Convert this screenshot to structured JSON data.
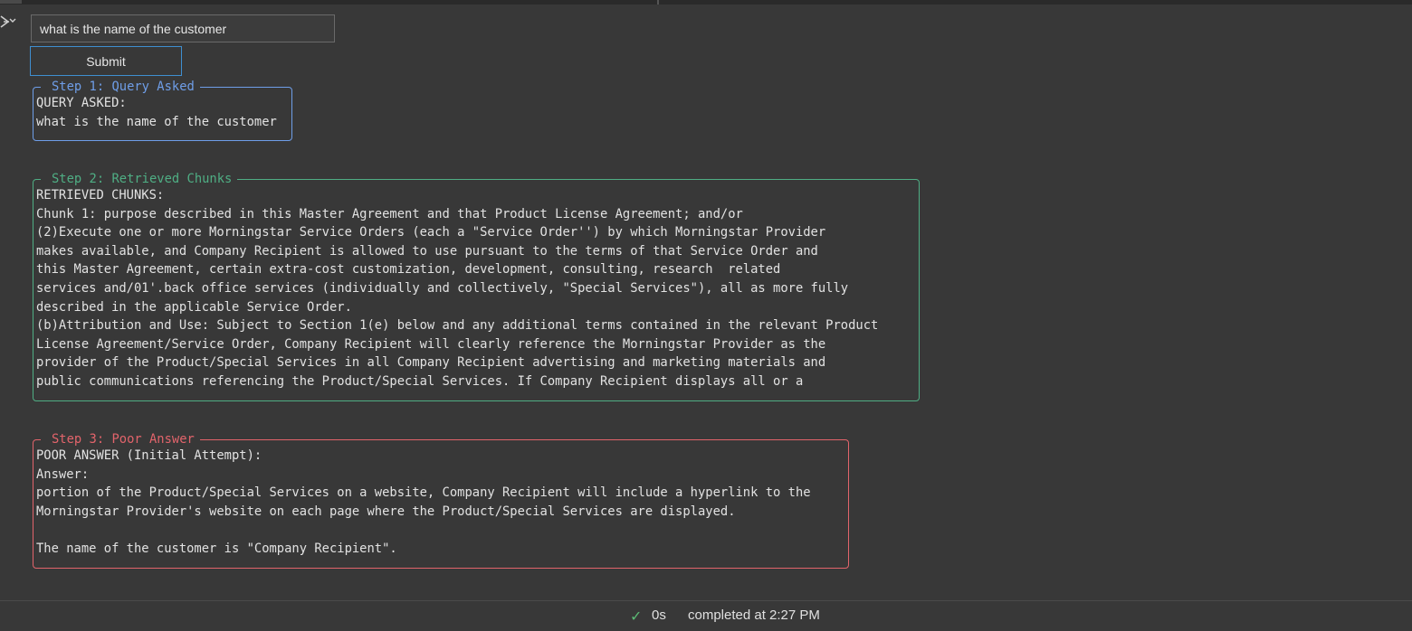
{
  "query": {
    "value": "what is the name of the customer"
  },
  "submit_label": "Submit",
  "steps": [
    {
      "title": "Step 1: Query Asked",
      "lines": [
        "QUERY ASKED:",
        "what is the name of the customer"
      ]
    },
    {
      "title": "Step 2: Retrieved Chunks",
      "lines": [
        "RETRIEVED CHUNKS:",
        "Chunk 1: purpose described in this Master Agreement and that Product License Agreement; and/or",
        "(2)Execute one or more Morningstar Service Orders (each a \"Service Order'') by which Morningstar Provider",
        "makes available, and Company Recipient is allowed to use pursuant to the terms of that Service Order and",
        "this Master Agreement, certain extra-cost customization, development, consulting, research  related",
        "services and/01'.back office services (individually and collectively, \"Special Services\"), all as more fully",
        "described in the applicable Service Order.",
        "(b)Attribution and Use: Subject to Section 1(e) below and any additional terms contained in the relevant Product",
        "License Agreement/Service Order, Company Recipient will clearly reference the Morningstar Provider as the",
        "provider of the Product/Special Services in all Company Recipient advertising and marketing materials and",
        "public communications referencing the Product/Special Services. If Company Recipient displays all or a"
      ]
    },
    {
      "title": "Step 3: Poor Answer",
      "lines": [
        "POOR ANSWER (Initial Attempt):",
        "Answer:",
        "portion of the Product/Special Services on a website, Company Recipient will include a hyperlink to the",
        "Morningstar Provider's website on each page where the Product/Special Services are displayed.",
        "",
        "The name of the customer is \"Company Recipient\"."
      ]
    }
  ],
  "status": {
    "duration": "0s",
    "completed": "completed at 2:27 PM"
  },
  "icons": {
    "output": "output-toggle-icon",
    "status": "check-icon"
  },
  "colors": {
    "step1": "#6f9ee8",
    "step2": "#4fae84",
    "step3": "#e2646b",
    "button_border": "#3f8fd0",
    "success": "#5bb974"
  }
}
